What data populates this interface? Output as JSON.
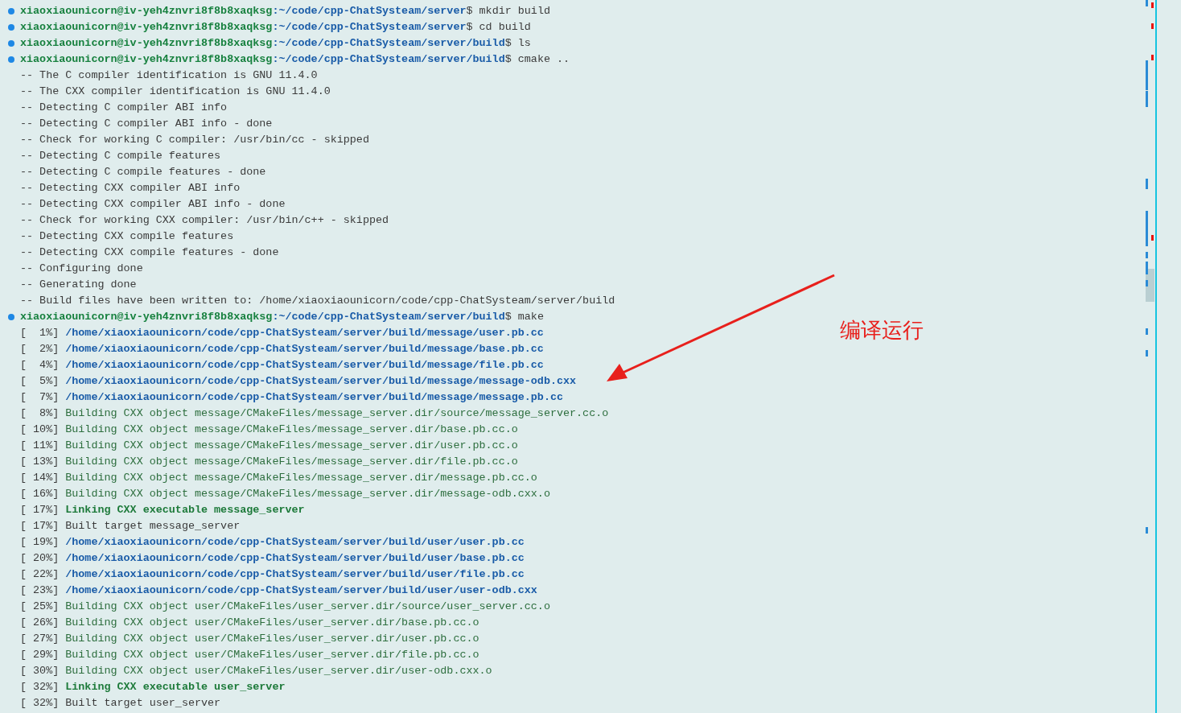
{
  "terminal": {
    "lines": [
      {
        "kind": "prompt",
        "user": "xiaoxiaounicorn@iv-yeh4znvri8f8b8xaqksg",
        "path": ":~/code/cpp-ChatSysteam/server",
        "command": "$ mkdir build"
      },
      {
        "kind": "prompt",
        "user": "xiaoxiaounicorn@iv-yeh4znvri8f8b8xaqksg",
        "path": ":~/code/cpp-ChatSysteam/server",
        "command": "$ cd build"
      },
      {
        "kind": "prompt",
        "user": "xiaoxiaounicorn@iv-yeh4znvri8f8b8xaqksg",
        "path": ":~/code/cpp-ChatSysteam/server/build",
        "command": "$ ls"
      },
      {
        "kind": "prompt",
        "user": "xiaoxiaounicorn@iv-yeh4znvri8f8b8xaqksg",
        "path": ":~/code/cpp-ChatSysteam/server/build",
        "command": "$ cmake .."
      },
      {
        "kind": "plain",
        "text": "-- The C compiler identification is GNU 11.4.0"
      },
      {
        "kind": "plain",
        "text": "-- The CXX compiler identification is GNU 11.4.0"
      },
      {
        "kind": "plain",
        "text": "-- Detecting C compiler ABI info"
      },
      {
        "kind": "plain",
        "text": "-- Detecting C compiler ABI info - done"
      },
      {
        "kind": "plain",
        "text": "-- Check for working C compiler: /usr/bin/cc - skipped"
      },
      {
        "kind": "plain",
        "text": "-- Detecting C compile features"
      },
      {
        "kind": "plain",
        "text": "-- Detecting C compile features - done"
      },
      {
        "kind": "plain",
        "text": "-- Detecting CXX compiler ABI info"
      },
      {
        "kind": "plain",
        "text": "-- Detecting CXX compiler ABI info - done"
      },
      {
        "kind": "plain",
        "text": "-- Check for working CXX compiler: /usr/bin/c++ - skipped"
      },
      {
        "kind": "plain",
        "text": "-- Detecting CXX compile features"
      },
      {
        "kind": "plain",
        "text": "-- Detecting CXX compile features - done"
      },
      {
        "kind": "plain",
        "text": "-- Configuring done"
      },
      {
        "kind": "plain",
        "text": "-- Generating done"
      },
      {
        "kind": "plain",
        "text": "-- Build files have been written to: /home/xiaoxiaounicorn/code/cpp-ChatSysteam/server/build"
      },
      {
        "kind": "prompt",
        "user": "xiaoxiaounicorn@iv-yeh4znvri8f8b8xaqksg",
        "path": ":~/code/cpp-ChatSysteam/server/build",
        "command": "$ make"
      },
      {
        "kind": "generate",
        "progress": "[  1%]",
        "text": "/home/xiaoxiaounicorn/code/cpp-ChatSysteam/server/build/message/user.pb.cc"
      },
      {
        "kind": "generate",
        "progress": "[  2%]",
        "text": "/home/xiaoxiaounicorn/code/cpp-ChatSysteam/server/build/message/base.pb.cc"
      },
      {
        "kind": "generate",
        "progress": "[  4%]",
        "text": "/home/xiaoxiaounicorn/code/cpp-ChatSysteam/server/build/message/file.pb.cc"
      },
      {
        "kind": "generate",
        "progress": "[  5%]",
        "text": "/home/xiaoxiaounicorn/code/cpp-ChatSysteam/server/build/message/message-odb.cxx"
      },
      {
        "kind": "generate",
        "progress": "[  7%]",
        "text": "/home/xiaoxiaounicorn/code/cpp-ChatSysteam/server/build/message/message.pb.cc"
      },
      {
        "kind": "build",
        "progress": "[  8%]",
        "text": "Building CXX object message/CMakeFiles/message_server.dir/source/message_server.cc.o"
      },
      {
        "kind": "build",
        "progress": "[ 10%]",
        "text": "Building CXX object message/CMakeFiles/message_server.dir/base.pb.cc.o"
      },
      {
        "kind": "build",
        "progress": "[ 11%]",
        "text": "Building CXX object message/CMakeFiles/message_server.dir/user.pb.cc.o"
      },
      {
        "kind": "build",
        "progress": "[ 13%]",
        "text": "Building CXX object message/CMakeFiles/message_server.dir/file.pb.cc.o"
      },
      {
        "kind": "build",
        "progress": "[ 14%]",
        "text": "Building CXX object message/CMakeFiles/message_server.dir/message.pb.cc.o"
      },
      {
        "kind": "build",
        "progress": "[ 16%]",
        "text": "Building CXX object message/CMakeFiles/message_server.dir/message-odb.cxx.o"
      },
      {
        "kind": "link",
        "progress": "[ 17%]",
        "text": "Linking CXX executable message_server"
      },
      {
        "kind": "target",
        "progress": "[ 17%]",
        "text": "Built target message_server"
      },
      {
        "kind": "generate",
        "progress": "[ 19%]",
        "text": "/home/xiaoxiaounicorn/code/cpp-ChatSysteam/server/build/user/user.pb.cc"
      },
      {
        "kind": "generate",
        "progress": "[ 20%]",
        "text": "/home/xiaoxiaounicorn/code/cpp-ChatSysteam/server/build/user/base.pb.cc"
      },
      {
        "kind": "generate",
        "progress": "[ 22%]",
        "text": "/home/xiaoxiaounicorn/code/cpp-ChatSysteam/server/build/user/file.pb.cc"
      },
      {
        "kind": "generate",
        "progress": "[ 23%]",
        "text": "/home/xiaoxiaounicorn/code/cpp-ChatSysteam/server/build/user/user-odb.cxx"
      },
      {
        "kind": "build",
        "progress": "[ 25%]",
        "text": "Building CXX object user/CMakeFiles/user_server.dir/source/user_server.cc.o"
      },
      {
        "kind": "build",
        "progress": "[ 26%]",
        "text": "Building CXX object user/CMakeFiles/user_server.dir/base.pb.cc.o"
      },
      {
        "kind": "build",
        "progress": "[ 27%]",
        "text": "Building CXX object user/CMakeFiles/user_server.dir/user.pb.cc.o"
      },
      {
        "kind": "build",
        "progress": "[ 29%]",
        "text": "Building CXX object user/CMakeFiles/user_server.dir/file.pb.cc.o"
      },
      {
        "kind": "build",
        "progress": "[ 30%]",
        "text": "Building CXX object user/CMakeFiles/user_server.dir/user-odb.cxx.o"
      },
      {
        "kind": "link",
        "progress": "[ 32%]",
        "text": "Linking CXX executable user_server"
      },
      {
        "kind": "target",
        "progress": "[ 32%]",
        "text": "Built target user_server"
      }
    ]
  },
  "annotation": {
    "text": "编译运行"
  }
}
